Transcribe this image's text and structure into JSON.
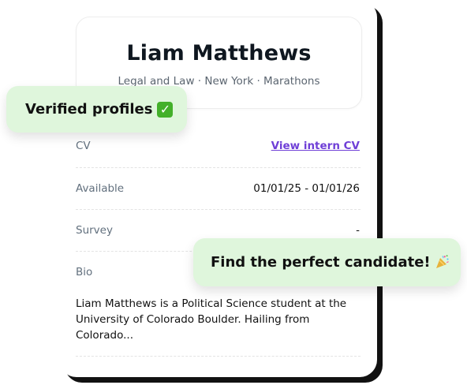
{
  "profile": {
    "name": "Liam Matthews",
    "meta": "Legal and Law · New York · Marathons"
  },
  "details": {
    "cv": {
      "label": "CV",
      "value": "View intern CV"
    },
    "available": {
      "label": "Available",
      "value": "01/01/25 - 01/01/26"
    },
    "survey": {
      "label": "Survey",
      "value": "-"
    },
    "bio": {
      "label": "Bio",
      "value": "Liam Matthews is a Political Science student at the University of Colorado Boulder. Hailing from Colorado..."
    }
  },
  "badges": {
    "verified_text": "Verified profiles",
    "verified_icon": "check-icon",
    "find_text": "Find the perfect candidate!",
    "find_icon": "party-popper-icon"
  },
  "colors": {
    "badge_bg": "#dff6dc",
    "link": "#6f3fd7",
    "card_shadow": "#111111"
  }
}
